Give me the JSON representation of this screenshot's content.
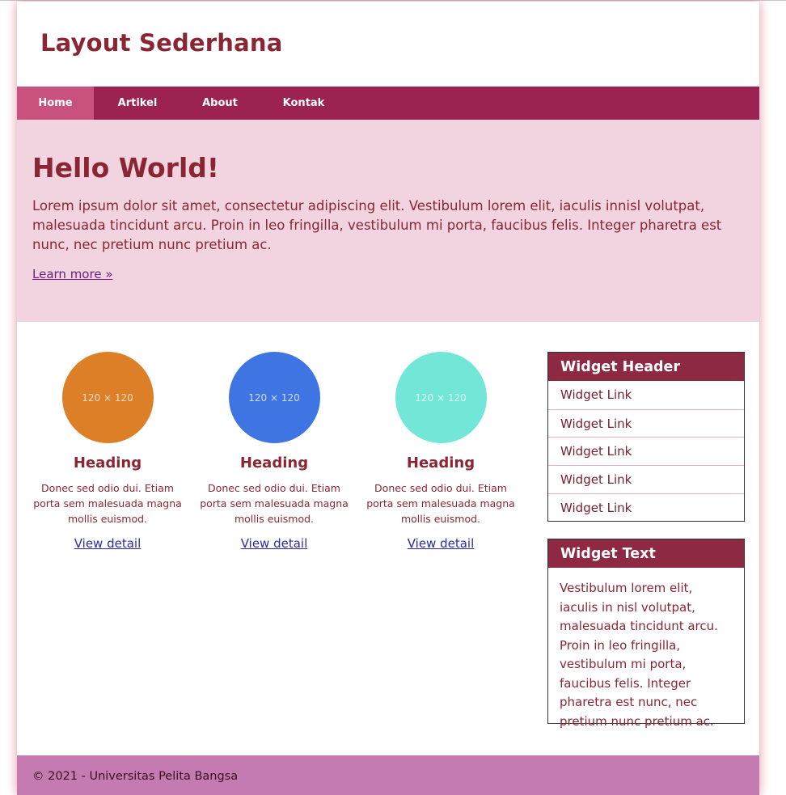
{
  "site": {
    "title": "Layout Sederhana"
  },
  "nav": {
    "items": [
      {
        "label": "Home",
        "active": true
      },
      {
        "label": "Artikel",
        "active": false
      },
      {
        "label": "About",
        "active": false
      },
      {
        "label": "Kontak",
        "active": false
      }
    ]
  },
  "hero": {
    "title": "Hello World!",
    "text": "Lorem ipsum dolor sit amet, consectetur adipiscing elit. Vestibulum lorem elit, iaculis innisl volutpat, malesuada tincidunt arcu. Proin in leo fringilla, vestibulum mi porta, faucibus felis. Integer pharetra est nunc, nec pretium nunc pretium ac.",
    "link_label": "Learn more »"
  },
  "features": [
    {
      "placeholder": "120 × 120",
      "color": "#dd7f26",
      "heading": "Heading",
      "text": "Donec sed odio dui. Etiam porta sem malesuada magna mollis euismod.",
      "link_label": "View detail"
    },
    {
      "placeholder": "120 × 120",
      "color": "#3f75e3",
      "heading": "Heading",
      "text": "Donec sed odio dui. Etiam porta sem malesuada magna mollis euismod.",
      "link_label": "View detail"
    },
    {
      "placeholder": "120 × 120",
      "color": "#72e7d7",
      "heading": "Heading",
      "text": "Donec sed odio dui. Etiam porta sem malesuada magna mollis euismod.",
      "link_label": "View detail"
    }
  ],
  "widget_links": {
    "header": "Widget Header",
    "links": [
      "Widget Link",
      "Widget Link",
      "Widget Link",
      "Widget Link",
      "Widget Link"
    ]
  },
  "widget_text": {
    "header": "Widget Text",
    "text": "Vestibulum lorem elit, iaculis in nisl volutpat, malesuada tincidunt arcu. Proin in leo fringilla, vestibulum mi porta, faucibus felis. Integer pharetra est nunc, nec pretium nunc pretium ac."
  },
  "footer": {
    "text": "© 2021 - Universitas Pelita Bangsa"
  },
  "colors": {
    "brand": "#8a2633",
    "nav_bg": "#9b2251",
    "nav_active": "#c8527d",
    "hero_bg": "#f1d4df",
    "widget_header": "#8d2942",
    "footer_bg": "#c47bb1"
  }
}
